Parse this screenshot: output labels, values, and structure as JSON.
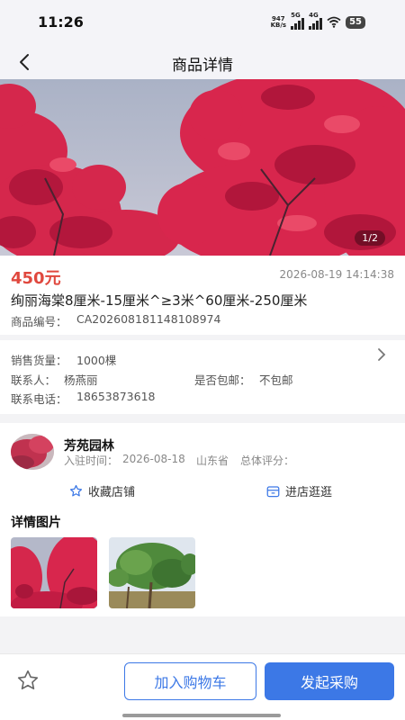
{
  "status_bar": {
    "time": "11:26",
    "net_speed_value": "947",
    "net_speed_unit": "KB/s",
    "sim1_label": "5G",
    "sim2_label": "4G",
    "battery": "55"
  },
  "header": {
    "title": "商品详情",
    "back_icon": "chevron-left-icon"
  },
  "gallery": {
    "pager": "1/2"
  },
  "product": {
    "price": "450元",
    "posted_time": "2026-08-19 14:14:38",
    "title": "绚丽海棠8厘米-15厘米^≥3米^60厘米-250厘米",
    "code_label": "商品编号：",
    "code": "CA202608181148108974"
  },
  "info": {
    "sales_label": "销售货量：",
    "sales_value": "1000棵",
    "contact_label": "联系人：",
    "contact_value": "杨燕丽",
    "shipping_label": "是否包邮：",
    "shipping_value": "不包邮",
    "phone_label": "联系电话：",
    "phone_value": "18653873618"
  },
  "shop": {
    "name": "芳苑园林",
    "join_label": "入驻时间：",
    "join_date": "2026-08-18",
    "province": "山东省",
    "rating_label": "总体评分：",
    "favorite_label": "收藏店铺",
    "visit_label": "进店逛逛"
  },
  "details": {
    "section_title": "详情图片"
  },
  "bottom_bar": {
    "add_cart_label": "加入购物车",
    "purchase_label": "发起采购"
  },
  "colors": {
    "accent": "#3c78e6",
    "price": "#e0483e",
    "blossom": "#d8254b"
  }
}
